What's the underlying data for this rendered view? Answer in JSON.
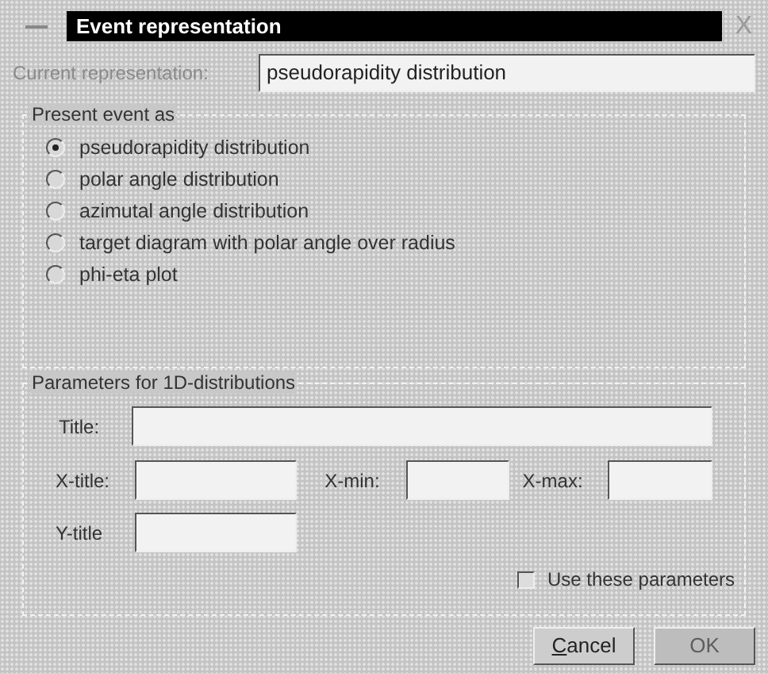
{
  "window": {
    "title": "Event representation",
    "close": "X"
  },
  "current": {
    "label": "Current representation:",
    "value": "pseudorapidity distribution",
    "disabled": true
  },
  "present_group": {
    "title": "Present event as",
    "options": [
      {
        "label": "pseudorapidity distribution",
        "selected": true
      },
      {
        "label": "polar angle distribution",
        "selected": false
      },
      {
        "label": "azimutal angle distribution",
        "selected": false
      },
      {
        "label": "target diagram with polar angle over radius",
        "selected": false
      },
      {
        "label": "phi-eta plot",
        "selected": false
      }
    ]
  },
  "params_group": {
    "title": "Parameters for 1D-distributions",
    "title_label": "Title:",
    "xtitle_label": "X-title:",
    "xmin_label": "X-min:",
    "xmax_label": "X-max:",
    "ytitle_label": "Y-title",
    "use": {
      "label": "Use these parameters",
      "checked": false
    }
  },
  "buttons": [
    {
      "label": "Cancel",
      "disabled": false
    },
    {
      "label": "OK",
      "disabled": true
    }
  ]
}
